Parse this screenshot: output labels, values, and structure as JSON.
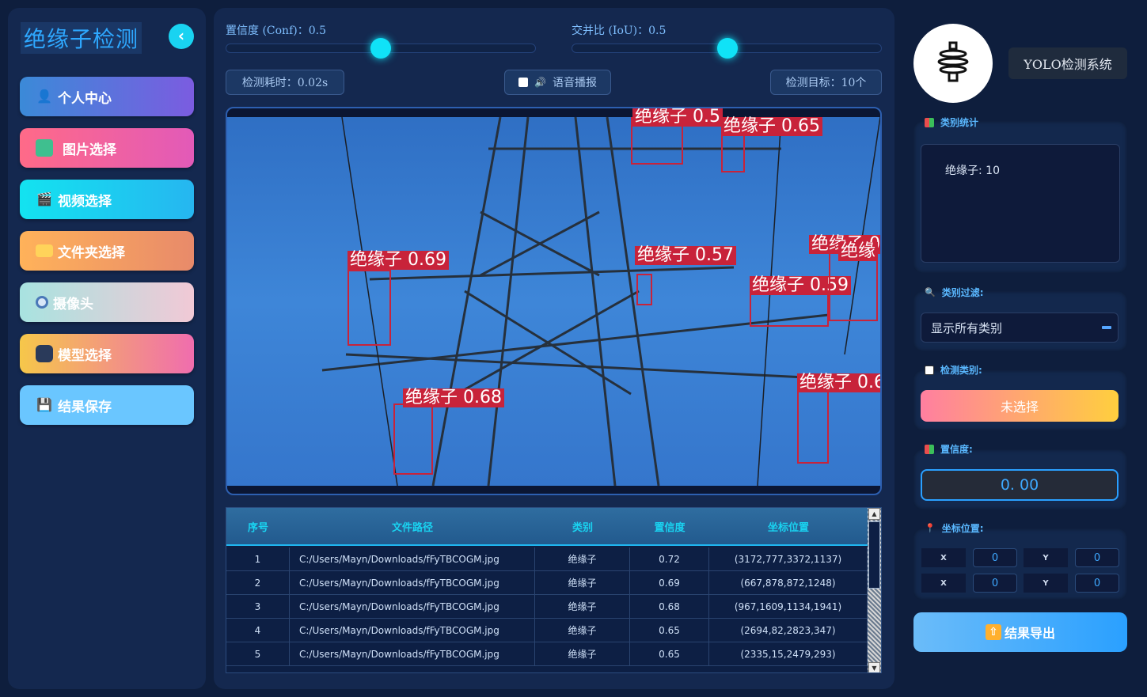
{
  "app": {
    "title": "绝缘子检测",
    "collapse_icon": "chevron-left-icon"
  },
  "nav": [
    {
      "label": "个人中心",
      "icon": "user-icon",
      "gradient": [
        "#3b8ad8",
        "#7b5ce0"
      ]
    },
    {
      "label": "图片选择",
      "icon": "image-icon",
      "gradient": [
        "#ff6a88",
        "#e25ab8"
      ]
    },
    {
      "label": "视频选择",
      "icon": "clapper-icon",
      "gradient": [
        "#13e3f0",
        "#26b6f0"
      ]
    },
    {
      "label": "文件夹选择",
      "icon": "folder-icon",
      "gradient": [
        "#ffb25a",
        "#e88a6a"
      ]
    },
    {
      "label": "摄像头",
      "icon": "webcam-icon",
      "gradient": [
        "#a8e3e0",
        "#f1c9d6"
      ]
    },
    {
      "label": "模型选择",
      "icon": "robot-icon",
      "gradient": [
        "#f6c74a",
        "#f06dae"
      ]
    },
    {
      "label": "结果保存",
      "icon": "floppy-icon",
      "gradient": [
        "#6ac6ff",
        "#6ac6ff"
      ]
    }
  ],
  "controls": {
    "conf_label": "置信度 (Conf)：0.5",
    "conf_value": 0.5,
    "iou_label": "交并比 (IoU)：0.5",
    "iou_value": 0.5,
    "time_label": "检测耗时：0.02s",
    "voice_label": "语音播报",
    "targets_label": "检测目标：10个"
  },
  "detections": [
    {
      "label": "绝缘子 0.69"
    },
    {
      "label": "绝缘子 0.68"
    },
    {
      "label": "绝缘子 0.57"
    },
    {
      "label": "绝缘子 0.59"
    },
    {
      "label": "绝缘子 0.65"
    },
    {
      "label": "绝缘子 0.6"
    },
    {
      "label": "绝缘子 0"
    },
    {
      "label": "绝缘"
    },
    {
      "label": "绝缘子 0.5"
    }
  ],
  "table": {
    "headers": [
      "序号",
      "文件路径",
      "类别",
      "置信度",
      "坐标位置"
    ],
    "rows": [
      [
        "1",
        "C:/Users/Mayn/Downloads/fFyTBCOGM.jpg",
        "绝缘子",
        "0.72",
        "(3172,777,3372,1137)"
      ],
      [
        "2",
        "C:/Users/Mayn/Downloads/fFyTBCOGM.jpg",
        "绝缘子",
        "0.69",
        "(667,878,872,1248)"
      ],
      [
        "3",
        "C:/Users/Mayn/Downloads/fFyTBCOGM.jpg",
        "绝缘子",
        "0.68",
        "(967,1609,1134,1941)"
      ],
      [
        "4",
        "C:/Users/Mayn/Downloads/fFyTBCOGM.jpg",
        "绝缘子",
        "0.65",
        "(2694,82,2823,347)"
      ],
      [
        "5",
        "C:/Users/Mayn/Downloads/fFyTBCOGM.jpg",
        "绝缘子",
        "0.65",
        "(2335,15,2479,293)"
      ]
    ]
  },
  "right": {
    "system_title": "YOLO检测系统",
    "class_stats_title": "类别统计",
    "class_stats_text": "绝缘子: 10",
    "filter_title": "类别过滤:",
    "filter_value": "显示所有类别",
    "detect_class_title": "检测类别:",
    "detect_class_value": "未选择",
    "conf_title": "置信度:",
    "conf_value": "0. 00",
    "coord_title": "坐标位置:",
    "coords": [
      {
        "label": "X",
        "value": "0"
      },
      {
        "label": "Y",
        "value": "0"
      },
      {
        "label": "X",
        "value": "0"
      },
      {
        "label": "Y",
        "value": "0"
      }
    ],
    "export_label": "结果导出"
  },
  "colors": {
    "accent": "#19d3f1",
    "detect_red": "#c8233a",
    "bg": "#0e1e3d"
  }
}
